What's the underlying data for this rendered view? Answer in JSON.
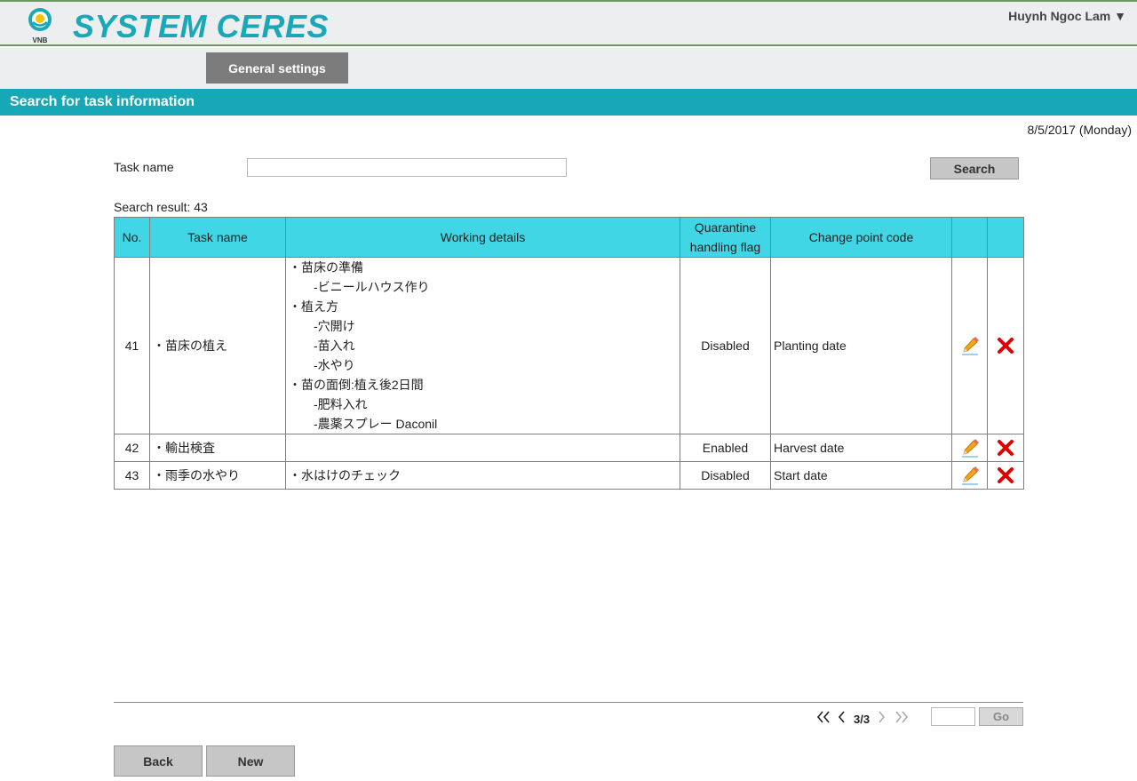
{
  "header": {
    "logo_text": "VNB",
    "app_title": "SYSTEM CERES",
    "user_name": "Huynh Ngoc Lam ▼"
  },
  "menu": {
    "general_settings": "General settings"
  },
  "section": {
    "title": "Search for task information"
  },
  "date_display": "8/5/2017 (Monday)",
  "search": {
    "label": "Task name",
    "value": "",
    "placeholder": "",
    "button": "Search"
  },
  "result": {
    "label": "Search result: 43"
  },
  "table": {
    "headers": {
      "no": "No.",
      "task_name": "Task name",
      "working_details": "Working details",
      "quarantine_line1": "Quarantine",
      "quarantine_line2": "handling flag",
      "change_point": "Change point code"
    },
    "rows": [
      {
        "no": "41",
        "task_name": "・苗床の植え",
        "details": [
          "・苗床の準備",
          "-ビニールハウス作り",
          "・植え方",
          "-穴開け",
          "-苗入れ",
          "-水やり",
          "・苗の面倒:植え後2日間",
          "-肥料入れ",
          "-農薬スプレー Daconil"
        ],
        "flag": "Disabled",
        "change_point": "Planting date"
      },
      {
        "no": "42",
        "task_name": "・輸出検査",
        "details": [],
        "flag": "Enabled",
        "change_point": "Harvest date"
      },
      {
        "no": "43",
        "task_name": "・雨季の水やり",
        "details": [
          "・水はけのチェック"
        ],
        "flag": "Disabled",
        "change_point": "Start date"
      }
    ]
  },
  "pagination": {
    "page_text": "3/3",
    "page_input_value": "",
    "go_label": "Go"
  },
  "buttons": {
    "back": "Back",
    "new": "New"
  },
  "icons": {
    "edit": "pencil-icon",
    "delete": "delete-x-icon",
    "first": "double-chevron-left-icon",
    "prev": "chevron-left-icon",
    "next": "chevron-right-icon",
    "last": "double-chevron-right-icon"
  },
  "colors": {
    "accent": "#17a8b8",
    "table_header": "#41d6e6",
    "header_border": "#6e9a5f",
    "delete_red": "#e00000",
    "menu_button": "#7b7b7b"
  }
}
